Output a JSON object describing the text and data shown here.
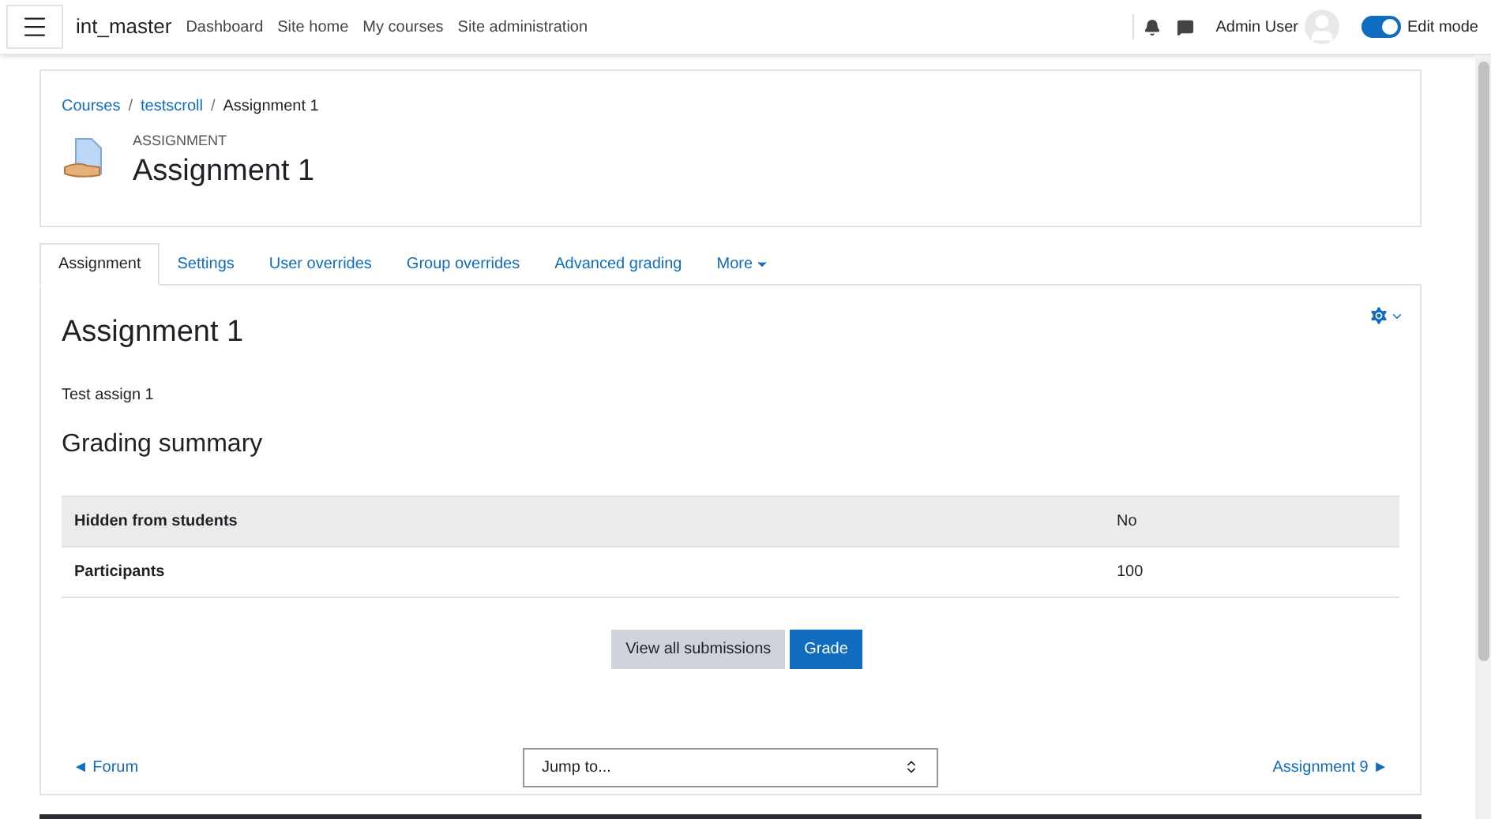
{
  "navbar": {
    "site_name": "int_master",
    "links": [
      "Dashboard",
      "Site home",
      "My courses",
      "Site administration"
    ],
    "user_name": "Admin User",
    "edit_mode": {
      "label": "Edit mode",
      "on": true
    }
  },
  "header": {
    "breadcrumbs": [
      {
        "kind": "link",
        "label": "Courses"
      },
      {
        "kind": "separator",
        "label": "/"
      },
      {
        "kind": "link",
        "label": "testscroll"
      },
      {
        "kind": "separator",
        "label": "/"
      },
      {
        "kind": "current",
        "label": "Assignment 1"
      }
    ],
    "module_type": "ASSIGNMENT",
    "title": "Assignment 1"
  },
  "tabs": [
    {
      "label": "Assignment",
      "selected": true
    },
    {
      "label": "Settings",
      "selected": false
    },
    {
      "label": "User overrides",
      "selected": false
    },
    {
      "label": "Group overrides",
      "selected": false
    },
    {
      "label": "Advanced grading",
      "selected": false
    },
    {
      "label": "More",
      "selected": false
    }
  ],
  "content": {
    "title": "Assignment 1",
    "description": "Test assign 1",
    "summary_title": "Grading summary",
    "rows": [
      {
        "label": "Hidden from students",
        "value": "No"
      },
      {
        "label": "Participants",
        "value": "100"
      }
    ],
    "buttons": [
      {
        "label": "View all submissions",
        "kind": "secondary"
      },
      {
        "label": "Grade",
        "kind": "primary"
      }
    ],
    "prev_link": "◄ Forum",
    "jump_placeholder": "Jump to...",
    "next_link": "Assignment 9 ►"
  }
}
